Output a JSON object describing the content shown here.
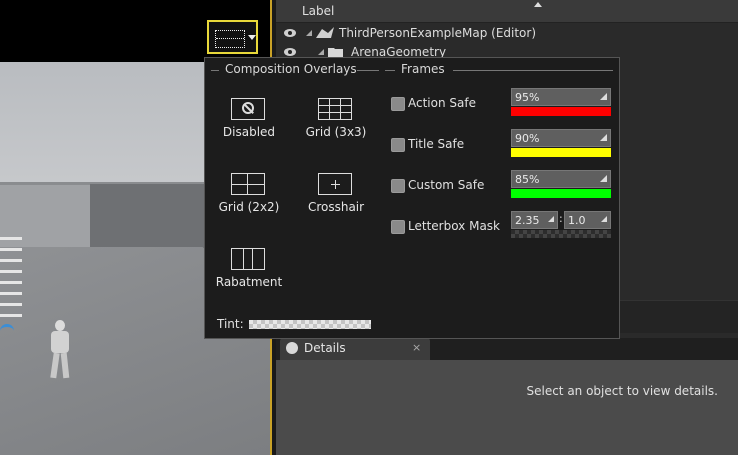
{
  "viewport": {
    "overlay_button_icon": "grid-overlay-icon"
  },
  "outliner": {
    "header_label": "Label",
    "rows": [
      {
        "label": "ThirdPersonExampleMap (Editor)",
        "icon": "map-icon"
      },
      {
        "label": "ArenaGeometry",
        "icon": "folder-icon"
      }
    ]
  },
  "details": {
    "tab_label": "Details",
    "close_label": "×",
    "empty_message": "Select an object to view details."
  },
  "popup": {
    "composition_title": "Composition Overlays",
    "frames_title": "Frames",
    "overlays": [
      {
        "label": "Disabled",
        "icon": "disabled-icon"
      },
      {
        "label": "Grid (3x3)",
        "icon": "grid-3x3-icon"
      },
      {
        "label": "Grid (2x2)",
        "icon": "grid-2x2-icon"
      },
      {
        "label": "Crosshair",
        "icon": "crosshair-icon"
      },
      {
        "label": "Rabatment",
        "icon": "rabatment-icon"
      }
    ],
    "frames": [
      {
        "label": "Action Safe",
        "value": "95%",
        "color": "#ff0000"
      },
      {
        "label": "Title Safe",
        "value": "90%",
        "color": "#ffff00"
      },
      {
        "label": "Custom Safe",
        "value": "85%",
        "color": "#00ff00"
      },
      {
        "label": "Letterbox Mask",
        "ratio_a": "2.35",
        "ratio_sep": ":",
        "ratio_b": "1.0"
      }
    ],
    "tint_label": "Tint:"
  }
}
